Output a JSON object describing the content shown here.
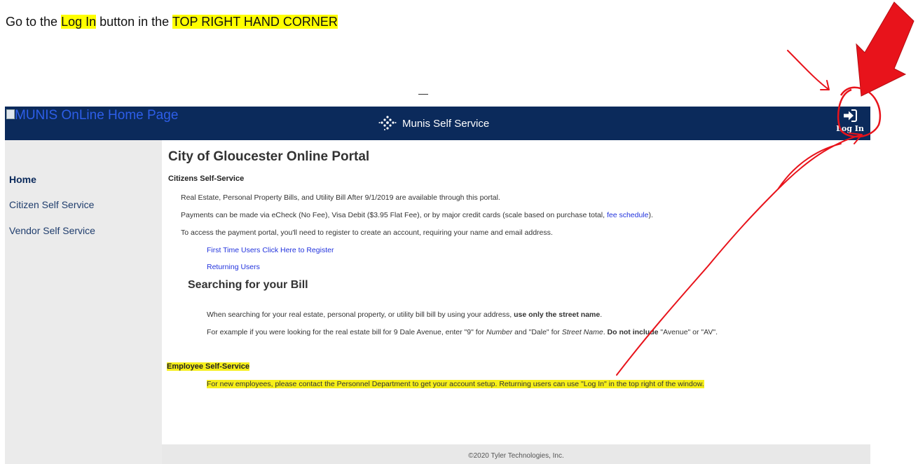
{
  "instruction": {
    "prefix": "Go to the ",
    "highlight1": "Log In",
    "middle": " button in the ",
    "highlight2": "TOP RIGHT HAND CORNER"
  },
  "header": {
    "logo_alt": "MUNIS OnLine Home Page",
    "brand": "Munis Self Service",
    "login_label": "Log In",
    "background": "#0b2a5b"
  },
  "sidebar": {
    "items": [
      {
        "label": "Home",
        "active": true
      },
      {
        "label": "Citizen Self Service"
      },
      {
        "label": "Vendor Self Service"
      }
    ]
  },
  "main": {
    "title": "City of Gloucester Online Portal",
    "citizens": {
      "heading": "Citizens Self-Service",
      "line1": "Real Estate, Personal Property Bills, and Utility Bill After 9/1/2019 are available through this portal.",
      "line2_prefix": "Payments can be made via eCheck (No Fee), Visa Debit ($3.95 Flat Fee), or by major credit cards (scale based on purchase total, ",
      "line2_link": "fee schedule",
      "line2_suffix": ").",
      "line3": "To access the payment portal, you'll need to register to create an account, requiring your name and email address.",
      "register_link": "First Time Users Click Here to Register",
      "returning_link": "Returning Users"
    },
    "searching": {
      "heading": "Searching for your Bill",
      "line1_prefix": "When searching for your real estate, personal property, or utility bill bill by using your address, ",
      "line1_bold": "use only the street name",
      "line1_suffix": ".",
      "line2_a": "For example if you were looking for the real estate bill for 9 Dale Avenue, enter \"9\" for ",
      "line2_number": "Number",
      "line2_b": " and \"Dale\" for ",
      "line2_street": "Street Name",
      "line2_c": ". ",
      "line2_bold": "Do not include",
      "line2_d": " \"Avenue\" or \"AV\"."
    },
    "employee": {
      "heading": "Employee Self-Service",
      "line1": "For new employees, please contact the Personnel Department to get your account setup. Returning users can use \"Log In\" in the top right of the window."
    },
    "footer": "©2020 Tyler Technologies, Inc."
  },
  "annotation_color": "#e8131b"
}
